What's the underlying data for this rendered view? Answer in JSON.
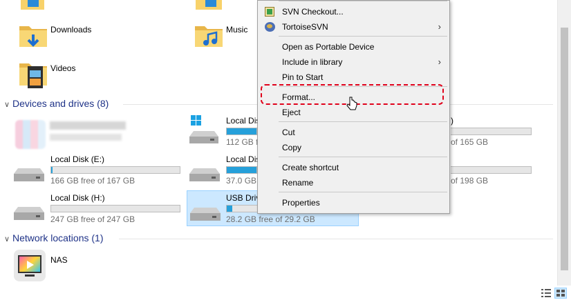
{
  "folders": [
    {
      "label": "Downloads",
      "icon": "downloads-folder-icon"
    },
    {
      "label": "Music",
      "icon": "music-folder-icon"
    },
    {
      "label": "Videos",
      "icon": "videos-folder-icon"
    }
  ],
  "devices_group": {
    "label": "Devices and drives (8)"
  },
  "network_group": {
    "label": "Network locations (1)"
  },
  "drives": {
    "c_label": "Local Dis",
    "c_free": "112 GB fre",
    "c_used_fraction": 0.32,
    "e_label": "Local Disk (E:)",
    "e_free": "166 GB free of 167 GB",
    "e_used_fraction": 0.01,
    "d_label": "Local Dis",
    "d_free": "37.0 GB fre",
    "d_used_fraction": 0.35,
    "h_label": "Local Disk (H:)",
    "h_free": "247 GB free of 247 GB",
    "h_used_fraction": 0.0,
    "usb_label": "USB Drive",
    "usb_free": "28.2 GB free of 29.2 GB",
    "usb_used_fraction": 0.04,
    "r1_label": ")",
    "r1_free": "of 165 GB",
    "r2_free": "of 198 GB"
  },
  "network": {
    "nas_label": "NAS"
  },
  "context_menu": {
    "svn_checkout": "SVN Checkout...",
    "tortoise_svn": "TortoiseSVN",
    "open_portable": "Open as Portable Device",
    "include_library": "Include in library",
    "pin_start": "Pin to Start",
    "format": "Format...",
    "eject": "Eject",
    "cut": "Cut",
    "copy": "Copy",
    "create_shortcut": "Create shortcut",
    "rename": "Rename",
    "properties": "Properties"
  },
  "colors": {
    "accent": "#26a0da",
    "highlight": "#cce8ff",
    "annotation": "#e0001a",
    "group_text": "#1e3287"
  }
}
